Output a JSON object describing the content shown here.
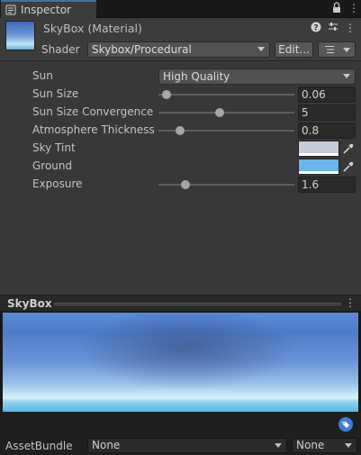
{
  "tab": {
    "title": "Inspector"
  },
  "header": {
    "title": "SkyBox (Material)",
    "shader_label": "Shader",
    "shader_value": "Skybox/Procedural",
    "edit_label": "Edit..."
  },
  "properties": {
    "sun": {
      "label": "Sun",
      "value": "High Quality"
    },
    "sun_size": {
      "label": "Sun Size",
      "value": "0.06",
      "fraction": 0.06
    },
    "sun_size_convergence": {
      "label": "Sun Size Convergence",
      "value": "5",
      "fraction": 0.45
    },
    "atmosphere_thickness": {
      "label": "Atmosphere Thickness",
      "value": "0.8",
      "fraction": 0.16
    },
    "sky_tint": {
      "label": "Sky Tint",
      "color": "#c7cbd9"
    },
    "ground": {
      "label": "Ground",
      "color": "#67b8e9"
    },
    "exposure": {
      "label": "Exposure",
      "value": "1.6",
      "fraction": 0.2
    }
  },
  "preview": {
    "title": "SkyBox"
  },
  "asset_bundle": {
    "label": "AssetBundle",
    "name_value": "None",
    "variant_value": "None"
  },
  "icons": {
    "tab": "inspector-icon",
    "lock": "lock-icon",
    "menu": "kebab-menu-icon",
    "help": "help-icon",
    "presets": "sliders-icon",
    "options": "list-icon",
    "picker": "eyedropper-icon",
    "tag": "tag-icon"
  },
  "colors": {
    "accent": "#3a72b0",
    "panel": "#383838"
  }
}
